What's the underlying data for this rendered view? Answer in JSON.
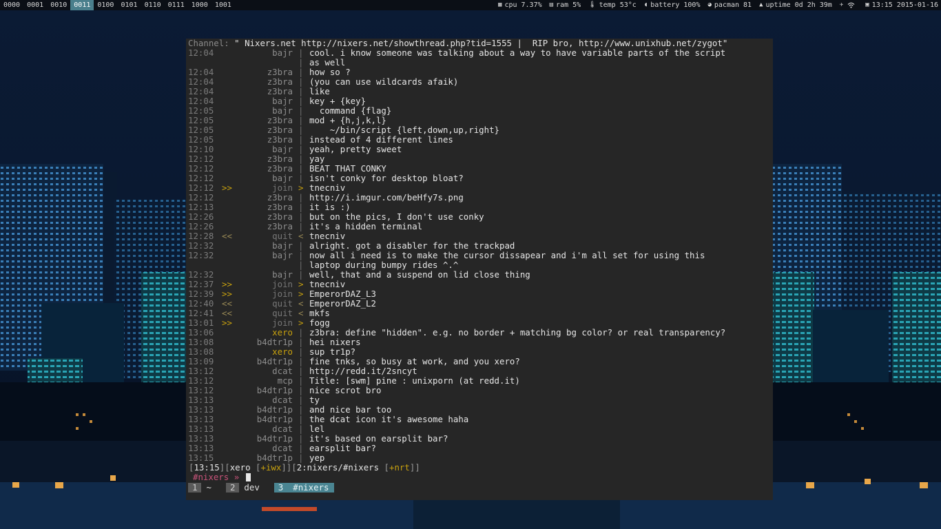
{
  "topbar": {
    "workspaces": [
      "0000",
      "0001",
      "0010",
      "0011",
      "0100",
      "0101",
      "0110",
      "0111",
      "1000",
      "1001"
    ],
    "active_workspace": "0011",
    "status": {
      "cpu": "cpu 7.37%",
      "ram": "ram 5%",
      "temp": "temp 53°c",
      "battery": "battery 100%",
      "pacman": "pacman 81",
      "uptime": "uptime 0d 2h 39m",
      "clock": "13:15 2015-01-16"
    },
    "icons": [
      "cpu-icon",
      "ram-icon",
      "temp-icon",
      "battery-icon",
      "pacman-icon",
      "uptime-icon",
      "pin-icon",
      "wifi-icon",
      "clock-icon"
    ]
  },
  "terminal": {
    "topic_label": "Channel:",
    "topic_text": "\" Nixers.net http://nixers.net/showthread.php?tid=1555 |  RIP bro, http://www.unixhub.net/zygot\"",
    "lines": [
      {
        "t": "12:04",
        "n": "bajr",
        "m": "cool. i know someone was talking about a way to have variable parts of the script"
      },
      {
        "t": "",
        "n": "",
        "m": "as well"
      },
      {
        "t": "12:04",
        "n": "z3bra",
        "m": "how so ?"
      },
      {
        "t": "12:04",
        "n": "z3bra",
        "m": "(you can use wildcards afaik)"
      },
      {
        "t": "12:04",
        "n": "z3bra",
        "m": "like"
      },
      {
        "t": "12:04",
        "n": "bajr",
        "m": "key + {key}"
      },
      {
        "t": "12:05",
        "n": "bajr",
        "m": "  command {flag}"
      },
      {
        "t": "12:05",
        "n": "z3bra",
        "m": "mod + {h,j,k,l}"
      },
      {
        "t": "12:05",
        "n": "z3bra",
        "m": "    ~/bin/script {left,down,up,right}"
      },
      {
        "t": "12:05",
        "n": "z3bra",
        "m": "instead of 4 different lines"
      },
      {
        "t": "12:10",
        "n": "bajr",
        "m": "yeah, pretty sweet"
      },
      {
        "t": "12:12",
        "n": "z3bra",
        "m": "yay"
      },
      {
        "t": "12:12",
        "n": "z3bra",
        "m": "BEAT THAT CONKY"
      },
      {
        "t": "12:12",
        "n": "bajr",
        "m": "isn't conky for desktop bloat?"
      },
      {
        "t": "12:12",
        "n": "join",
        "m": "tnecniv"
      },
      {
        "t": "12:12",
        "n": "z3bra",
        "m": "http://i.imgur.com/beHfy7s.png"
      },
      {
        "t": "12:13",
        "n": "z3bra",
        "m": "it is :)"
      },
      {
        "t": "12:26",
        "n": "z3bra",
        "m": "but on the pics, I don't use conky"
      },
      {
        "t": "12:26",
        "n": "z3bra",
        "m": "it's a hidden terminal"
      },
      {
        "t": "12:28",
        "n": "quit",
        "m": "tnecniv"
      },
      {
        "t": "12:32",
        "n": "bajr",
        "m": "alright. got a disabler for the trackpad"
      },
      {
        "t": "12:32",
        "n": "bajr",
        "m": "now all i need is to make the cursor dissapear and i'm all set for using this"
      },
      {
        "t": "",
        "n": "",
        "m": "laptop during bumpy rides ^.^"
      },
      {
        "t": "12:32",
        "n": "bajr",
        "m": "well, that and a suspend on lid close thing"
      },
      {
        "t": "12:37",
        "n": "join",
        "m": "tnecniv"
      },
      {
        "t": "12:39",
        "n": "join",
        "m": "EmperorDAZ_L3"
      },
      {
        "t": "12:40",
        "n": "quit",
        "m": "EmperorDAZ_L2"
      },
      {
        "t": "12:41",
        "n": "quit",
        "m": "mkfs"
      },
      {
        "t": "13:01",
        "n": "join",
        "m": "fogg"
      },
      {
        "t": "13:06",
        "n": "xero",
        "m": "z3bra: define \"hidden\". e.g. no border + matching bg color? or real transparency?"
      },
      {
        "t": "13:08",
        "n": "b4dtr1p",
        "m": "hei nixers"
      },
      {
        "t": "13:08",
        "n": "xero",
        "m": "sup tr1p?"
      },
      {
        "t": "13:09",
        "n": "b4dtr1p",
        "m": "fine tnks, so busy at work, and you xero?"
      },
      {
        "t": "13:12",
        "n": "dcat",
        "m": "http://redd.it/2sncyt"
      },
      {
        "t": "13:12",
        "n": "mcp",
        "m": "Title: [swm] pine : unixporn (at redd.it)"
      },
      {
        "t": "13:12",
        "n": "b4dtr1p",
        "m": "nice scrot bro"
      },
      {
        "t": "13:13",
        "n": "dcat",
        "m": "ty"
      },
      {
        "t": "13:13",
        "n": "b4dtr1p",
        "m": "and nice bar too"
      },
      {
        "t": "13:13",
        "n": "b4dtr1p",
        "m": "the dcat icon it's awesome haha"
      },
      {
        "t": "13:13",
        "n": "dcat",
        "m": "lel"
      },
      {
        "t": "13:13",
        "n": "b4dtr1p",
        "m": "it's based on earsplit bar?"
      },
      {
        "t": "13:13",
        "n": "dcat",
        "m": "earsplit bar?"
      },
      {
        "t": "13:15",
        "n": "b4dtr1p",
        "m": "yep"
      }
    ],
    "statusline": {
      "time": "13:15",
      "user": "xero",
      "user_modes": "+iwx",
      "window": "2:nixers/#nixers",
      "chan_modes": "+nrt"
    },
    "prompt": {
      "channel": "#nixers",
      "arrow": "»"
    },
    "tmux_windows": [
      {
        "num": "1",
        "name": "~"
      },
      {
        "num": "2",
        "name": "dev"
      },
      {
        "num": "3",
        "name": "#nixers"
      }
    ]
  }
}
